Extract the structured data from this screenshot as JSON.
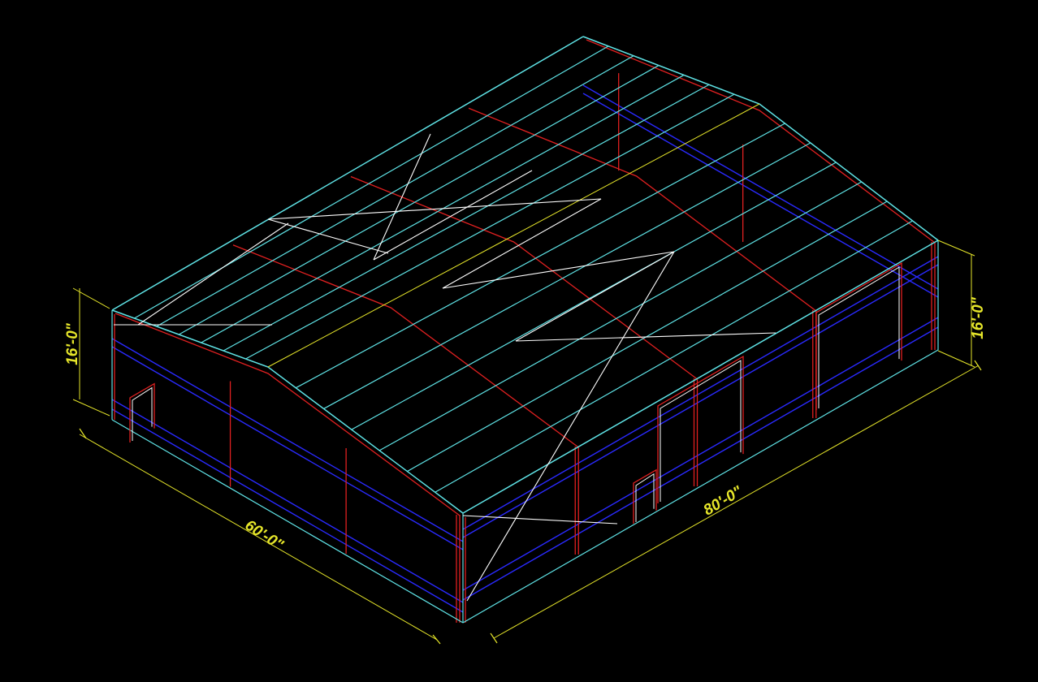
{
  "drawing": {
    "background": "#000000",
    "colors": {
      "roof_purlin": "#5fe3e6",
      "frame": "#e02020",
      "girt": "#2a2aff",
      "bracing": "#ffffff",
      "dimension": "#e6e62a",
      "ridge_line": "#e6e62a"
    },
    "dimensions": {
      "width_label": "60'-0\"",
      "length_label": "80'-0\"",
      "eave_height_left_label": "16'-0\"",
      "eave_height_right_label": "16'-0\""
    }
  }
}
